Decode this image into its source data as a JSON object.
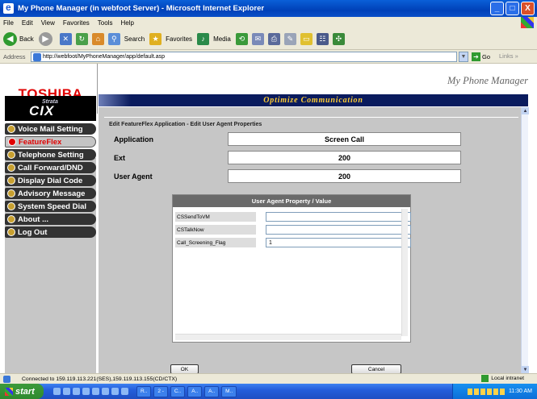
{
  "window": {
    "title": "My Phone Manager (in webfoot Server) - Microsoft Internet Explorer",
    "controls": [
      "_",
      "□",
      "X"
    ]
  },
  "menu": [
    "File",
    "Edit",
    "View",
    "Favorites",
    "Tools",
    "Help"
  ],
  "toolbar": {
    "back": "Back",
    "search": "Search",
    "favorites": "Favorites",
    "media": "Media"
  },
  "address": {
    "label": "Address",
    "url": "http://webfoot/MyPhoneManager/app/default.asp",
    "go": "Go",
    "links": "Links"
  },
  "header": {
    "brand": "TOSHIBA",
    "app_title": "My Phone Manager",
    "strata_top": "Strata",
    "strata_logo": "CIX",
    "banner": "Optimize Communication"
  },
  "nav": [
    {
      "label": "Voice Mail Setting",
      "active": false
    },
    {
      "label": "FeatureFlex",
      "active": true
    },
    {
      "label": "Telephone Setting",
      "active": false
    },
    {
      "label": "Call Forward/DND",
      "active": false
    },
    {
      "label": "Display Dial Code",
      "active": false
    },
    {
      "label": "Advisory Message",
      "active": false
    },
    {
      "label": "System Speed Dial",
      "active": false
    },
    {
      "label": "About ...",
      "active": false
    },
    {
      "label": "Log Out",
      "active": false
    }
  ],
  "form": {
    "legend": "Edit FeatureFlex Application - Edit  User Agent Properties",
    "fields": [
      {
        "label": "Application",
        "value": "Screen Call"
      },
      {
        "label": "Ext",
        "value": "200"
      },
      {
        "label": "User Agent",
        "value": "200"
      }
    ],
    "panel_title": "User Agent Property / Value",
    "properties": [
      {
        "name": "CSSendToVM",
        "value": ""
      },
      {
        "name": "CSTalkNow",
        "value": ""
      },
      {
        "name": "Call_Screening_Flag",
        "value": "1"
      }
    ],
    "ok": "OK",
    "cancel": "Cancel"
  },
  "status": {
    "text": "Connected to 159.119.113.221(SES),159.119.113.155(CD/CTX)",
    "zone": "Local intranet"
  },
  "taskbar": {
    "start": "start",
    "tasks": [
      "R..",
      "2 -",
      "C..",
      "A..",
      "A..",
      "M.."
    ],
    "time": "11:30 AM"
  }
}
